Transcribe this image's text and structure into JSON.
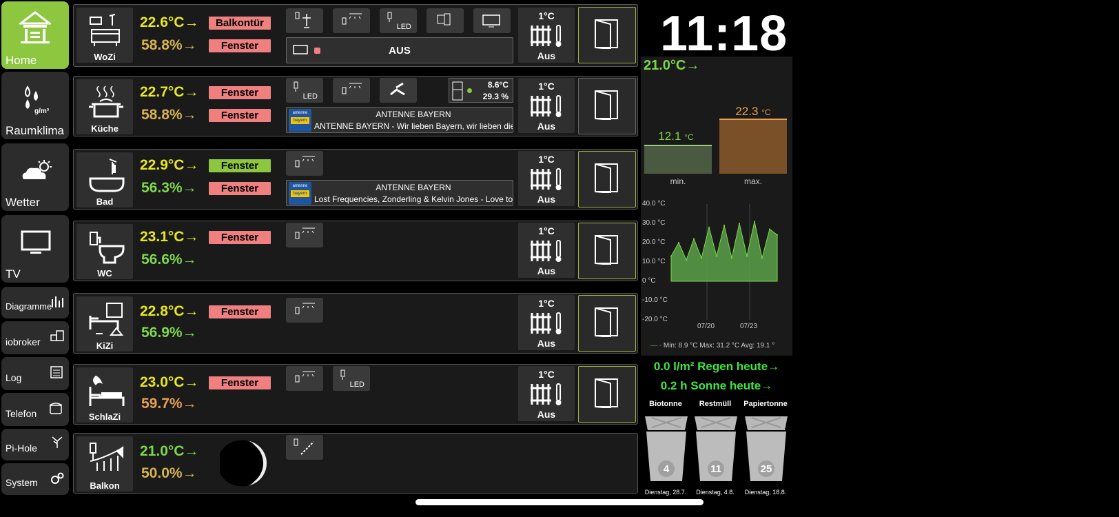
{
  "nav": [
    {
      "label": "Home"
    },
    {
      "label": "Raumklima"
    },
    {
      "label": "Wetter"
    },
    {
      "label": "TV"
    },
    {
      "label": "Diagramme"
    },
    {
      "label": "iobroker"
    },
    {
      "label": "Log"
    },
    {
      "label": "Telefon"
    },
    {
      "label": "Pi-Hole"
    },
    {
      "label": "System"
    }
  ],
  "nav_extra": {
    "raumklima_unit": "g/m³"
  },
  "rooms": [
    {
      "name": "WoZi",
      "temp": "22.6°C→",
      "hum": "58.8%→",
      "badge1": "Balkontür",
      "badge2": "Fenster",
      "heat_val": "1°C",
      "heat_state": "Aus"
    },
    {
      "name": "Küche",
      "temp": "22.7°C→",
      "hum": "58.8%→",
      "badge1": "Fenster",
      "badge2": "Fenster",
      "heat_val": "1°C",
      "heat_state": "Aus"
    },
    {
      "name": "Bad",
      "temp": "22.9°C→",
      "hum": "56.3%→",
      "badge1": "Fenster",
      "badge2": "Fenster",
      "heat_val": "1°C",
      "heat_state": "Aus"
    },
    {
      "name": "WC",
      "temp": "23.1°C→",
      "hum": "56.6%→",
      "badge1": "Fenster",
      "heat_val": "1°C",
      "heat_state": "Aus"
    },
    {
      "name": "KiZi",
      "temp": "22.8°C→",
      "hum": "56.9%→",
      "badge1": "Fenster",
      "heat_val": "1°C",
      "heat_state": "Aus"
    },
    {
      "name": "SchlaZi",
      "temp": "23.0°C→",
      "hum": "59.7%→",
      "badge1": "Fenster",
      "heat_val": "1°C",
      "heat_state": "Aus"
    },
    {
      "name": "Balkon",
      "temp": "21.0°C→",
      "hum": "50.0%→"
    }
  ],
  "buttons": {
    "led": "LED",
    "tv_state": "AUS"
  },
  "fridge": {
    "temp": "8.6°C",
    "hum": "29.3 %"
  },
  "radio": [
    {
      "station": "ANTENNE BAYERN",
      "track": "ANTENNE BAYERN - Wir lieben Bayern, wir lieben die Hits"
    },
    {
      "station": "ANTENNE BAYERN",
      "track": "Lost Frequencies, Zonderling & Kelvin Jones - Love to Go"
    }
  ],
  "radio_logo": {
    "top": "antenne",
    "bottom": "bayern"
  },
  "clock": "11:18",
  "outside_temp": "21.0°C→",
  "minmax": {
    "min_val": "12.1",
    "max_val": "22.3",
    "unit": "°C",
    "min_label": "min.",
    "max_label": "max."
  },
  "chart_data": {
    "type": "area",
    "ylim": [
      -20,
      40
    ],
    "yticks": [
      "40.0 °C",
      "30.0 °C",
      "20.0 °C",
      "10.0 °C",
      "0 °C",
      "-10.0 °C",
      "-20.0 °C"
    ],
    "xticks": [
      "07/20",
      "07/23"
    ],
    "legend": "Min: 8.9 °C  Max: 31.2 °C  Avg: 19.1 °",
    "x": [
      "07/17",
      "07/17",
      "07/18",
      "07/18",
      "07/19",
      "07/19",
      "07/20",
      "07/20",
      "07/21",
      "07/21",
      "07/22",
      "07/22",
      "07/23",
      "07/23",
      "07/24"
    ],
    "values": [
      13,
      20,
      11,
      22,
      12,
      28,
      13,
      29,
      12,
      30,
      13,
      31,
      12,
      27,
      24
    ],
    "color": "#5aa24a"
  },
  "rain": "0.0 l/m² Regen heute→",
  "sun": "0.2 h Sonne heute→",
  "bins": [
    {
      "label": "Biotonne",
      "days": "4",
      "date": "Dienstag, 28.7."
    },
    {
      "label": "Restmüll",
      "days": "11",
      "date": "Dienstag, 4.8."
    },
    {
      "label": "Papiertonne",
      "days": "25",
      "date": "Dienstag, 18.8."
    }
  ],
  "colors": {
    "yellow": "#e8e81e",
    "green": "#7ed84a",
    "gold": "#d8b450",
    "orange": "#e8a050",
    "accent": "#8dc63f",
    "badge_red": "#f08080"
  }
}
